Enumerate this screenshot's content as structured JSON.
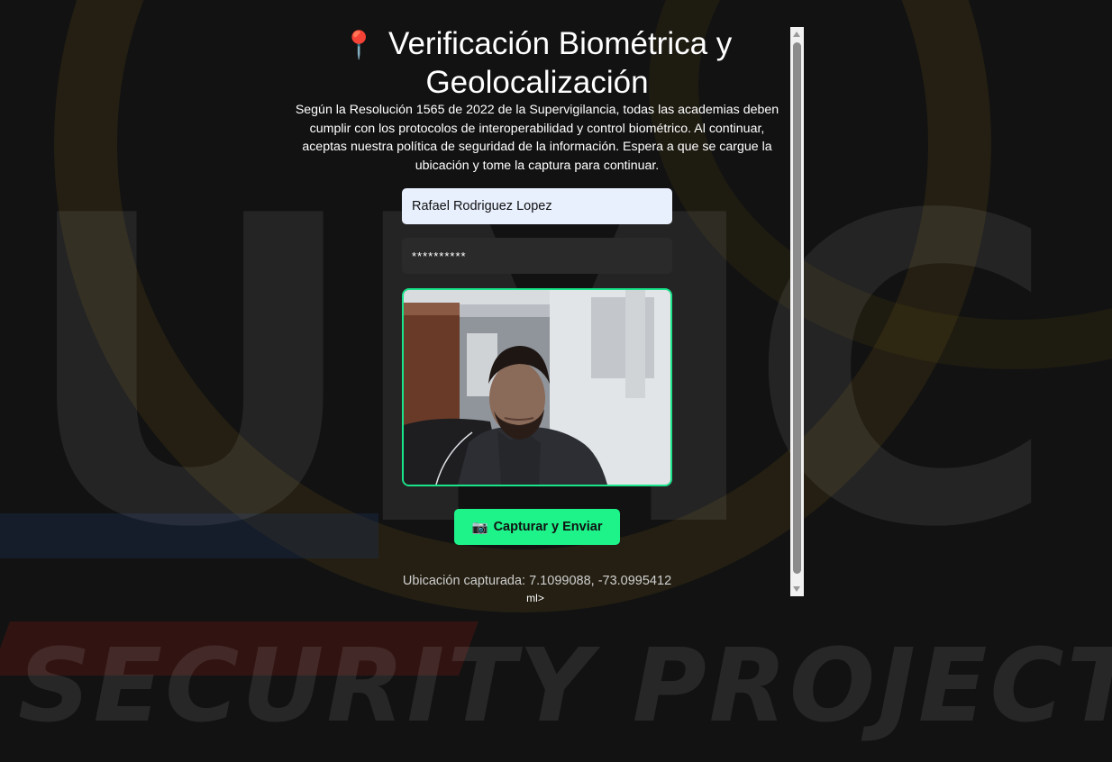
{
  "background": {
    "logo_letters": "UMC",
    "tagline": "SECURITY PROJECTS"
  },
  "header": {
    "icon": "round-pushpin-icon",
    "title": "Verificación Biométrica y Geolocalización"
  },
  "description": "Según la Resolución 1565 de 2022 de la Supervigilancia, todas las academias deben cumplir con los protocolos de interoperabilidad y control biométrico. Al continuar, aceptas nuestra política de seguridad de la información. Espera a que se cargue la ubicación y tome la captura para continuar.",
  "form": {
    "name_value": "Rafael Rodriguez Lopez",
    "password_value": "**********"
  },
  "camera": {
    "border_color": "#19e48a"
  },
  "capture_button": {
    "icon": "camera-icon",
    "label": "Capturar y Enviar",
    "color": "#1df389"
  },
  "location": {
    "text": "Ubicación capturada: 7.1099088, -73.0995412"
  },
  "stray_text": "ml>"
}
